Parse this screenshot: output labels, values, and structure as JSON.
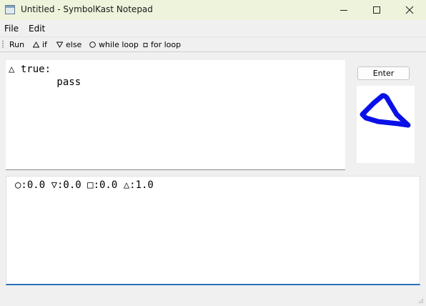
{
  "window": {
    "title": "Untitled - SymbolKast Notepad"
  },
  "menu": [
    "File",
    "Edit"
  ],
  "toolbar": {
    "run": "Run",
    "if": "if",
    "else": "else",
    "while_loop": "while loop",
    "for_loop": "for loop"
  },
  "editor": {
    "code": "△ true:\n        pass"
  },
  "sidebar": {
    "enter_label": "Enter",
    "drawn_shape": "triangle",
    "stroke_color": "#0a10e8"
  },
  "console": {
    "output": "○:0.0 ▽:0.0 □:0.0 △:1.0"
  }
}
